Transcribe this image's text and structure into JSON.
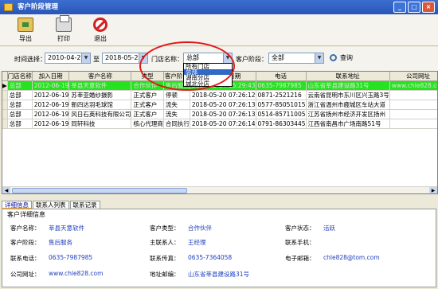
{
  "window": {
    "title": "客户阶段管理",
    "controls": [
      "_",
      "□",
      "×"
    ]
  },
  "toolbar": {
    "export_label": "导出",
    "print_label": "打印",
    "exit_label": "退出"
  },
  "filters": {
    "time_label": "时间选择：",
    "date_from": "2010-04-25",
    "to_label": "至",
    "date_to": "2018-05-25",
    "store_label": "门店名称：",
    "store_value": "总部",
    "stage_label": "客户阶段：",
    "stage_value": "全部",
    "query_label": "查询"
  },
  "store_dropdown": {
    "options": [
      "所有门店",
      "总部",
      "湖南分店",
      "城北分店"
    ],
    "selected": "总部"
  },
  "table": {
    "columns": [
      "门店名称",
      "加入日期",
      "客户名称",
      "类型",
      "客户阶段",
      "最后联系日期",
      "电话",
      "联系地址",
      "公司网址"
    ],
    "rows": [
      [
        "总部",
        "2012-06-19",
        "莘县天意软件",
        "合作伙伴",
        "售后服务",
        "2017-05-04 15:29:43",
        "0635-7987985",
        "山东省莘县建设路31号",
        "www.chle828.com"
      ],
      [
        "总部",
        "2012-06-19",
        "苏莘亚婚纱摄影",
        "正式客户",
        "停顿",
        "2018-05-20 07:26:12",
        "0871-2521216",
        "云南省昆明市东川区兴玉路3号",
        ""
      ],
      [
        "总部",
        "2012-06-19",
        "新四达羽毛球馆",
        "正式客户",
        "流失",
        "2018-05-20 07:26:13",
        "0577-85051015",
        "浙江省温州市鹿城区车站大道",
        ""
      ],
      [
        "总部",
        "2012-06-19",
        "风日石英科技有限公司",
        "正式客户",
        "流失",
        "2018-05-20 07:26:13",
        "0514-85711005",
        "江苏省扬州市经济开发区扬州",
        ""
      ],
      [
        "总部",
        "2012-06-19",
        "同轩科技",
        "核心代理商",
        "合同执行",
        "2018-05-20 07:26:14",
        "0791-86303445",
        "江西省南昌市广场南路51号",
        ""
      ]
    ],
    "highlight_row": 0,
    "current_row_marker": "▶"
  },
  "tabs": [
    "详细信息",
    "联系人列表",
    "联系记录"
  ],
  "details": {
    "header": "客户详细信息",
    "fields": [
      {
        "label": "客户名称：",
        "value": "莘县天意软件"
      },
      {
        "label": "客户类型：",
        "value": "合作伙伴"
      },
      {
        "label": "客户状态：",
        "value": "活跃"
      },
      {
        "label": "客户阶段：",
        "value": "售后服务"
      },
      {
        "label": "主联系人：",
        "value": "王经理"
      },
      {
        "label": "联系手机：",
        "value": ""
      },
      {
        "label": "联系电话：",
        "value": "0635-7987985"
      },
      {
        "label": "联系传真：",
        "value": "0635-7364058"
      },
      {
        "label": "电子邮箱：",
        "value": "chle828@tom.com"
      },
      {
        "label": "公司网址：",
        "value": "www.chle828.com"
      },
      {
        "label": "地址邮编：",
        "value": "山东省莘县建设路31号"
      }
    ]
  },
  "colors": {
    "highlight_row": "#25e31f",
    "title_bar": "#2a55b8",
    "value_text": "#1f3fbf",
    "annotation_circle": "#e01818"
  }
}
